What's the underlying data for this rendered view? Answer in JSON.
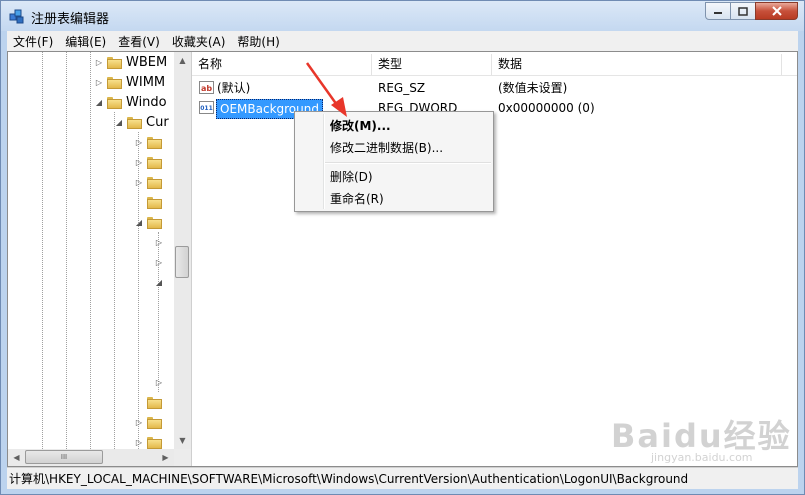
{
  "window": {
    "title": "注册表编辑器"
  },
  "menu": [
    "文件(F)",
    "编辑(E)",
    "查看(V)",
    "收藏夹(A)",
    "帮助(H)"
  ],
  "tree": {
    "nodes": [
      {
        "label": "WBEM",
        "expander": "▷"
      },
      {
        "label": "WIMM",
        "expander": "▷"
      },
      {
        "label": "Windo",
        "expander": "◢"
      },
      {
        "label": "Cur",
        "expander": "◢"
      }
    ],
    "scroll_h_grip": "III"
  },
  "list": {
    "columns": [
      "名称",
      "类型",
      "数据"
    ],
    "rows": [
      {
        "icon": "ab",
        "name": "(默认)",
        "type": "REG_SZ",
        "data": "(数值未设置)"
      },
      {
        "icon": "011",
        "name": "OEMBackground",
        "type": "REG_DWORD",
        "data": "0x00000000 (0)"
      }
    ]
  },
  "context_menu": {
    "items": [
      "修改(M)...",
      "修改二进制数据(B)...",
      "删除(D)",
      "重命名(R)"
    ]
  },
  "status": {
    "path": "计算机\\HKEY_LOCAL_MACHINE\\SOFTWARE\\Microsoft\\Windows\\CurrentVersion\\Authentication\\LogonUI\\Background"
  },
  "watermark": {
    "text": "Baidu经验",
    "sub": "jingyan.baidu.com"
  },
  "colors": {
    "selection": "#3399ff",
    "arrow": "#e8362a",
    "close_button": "#c7503a"
  }
}
